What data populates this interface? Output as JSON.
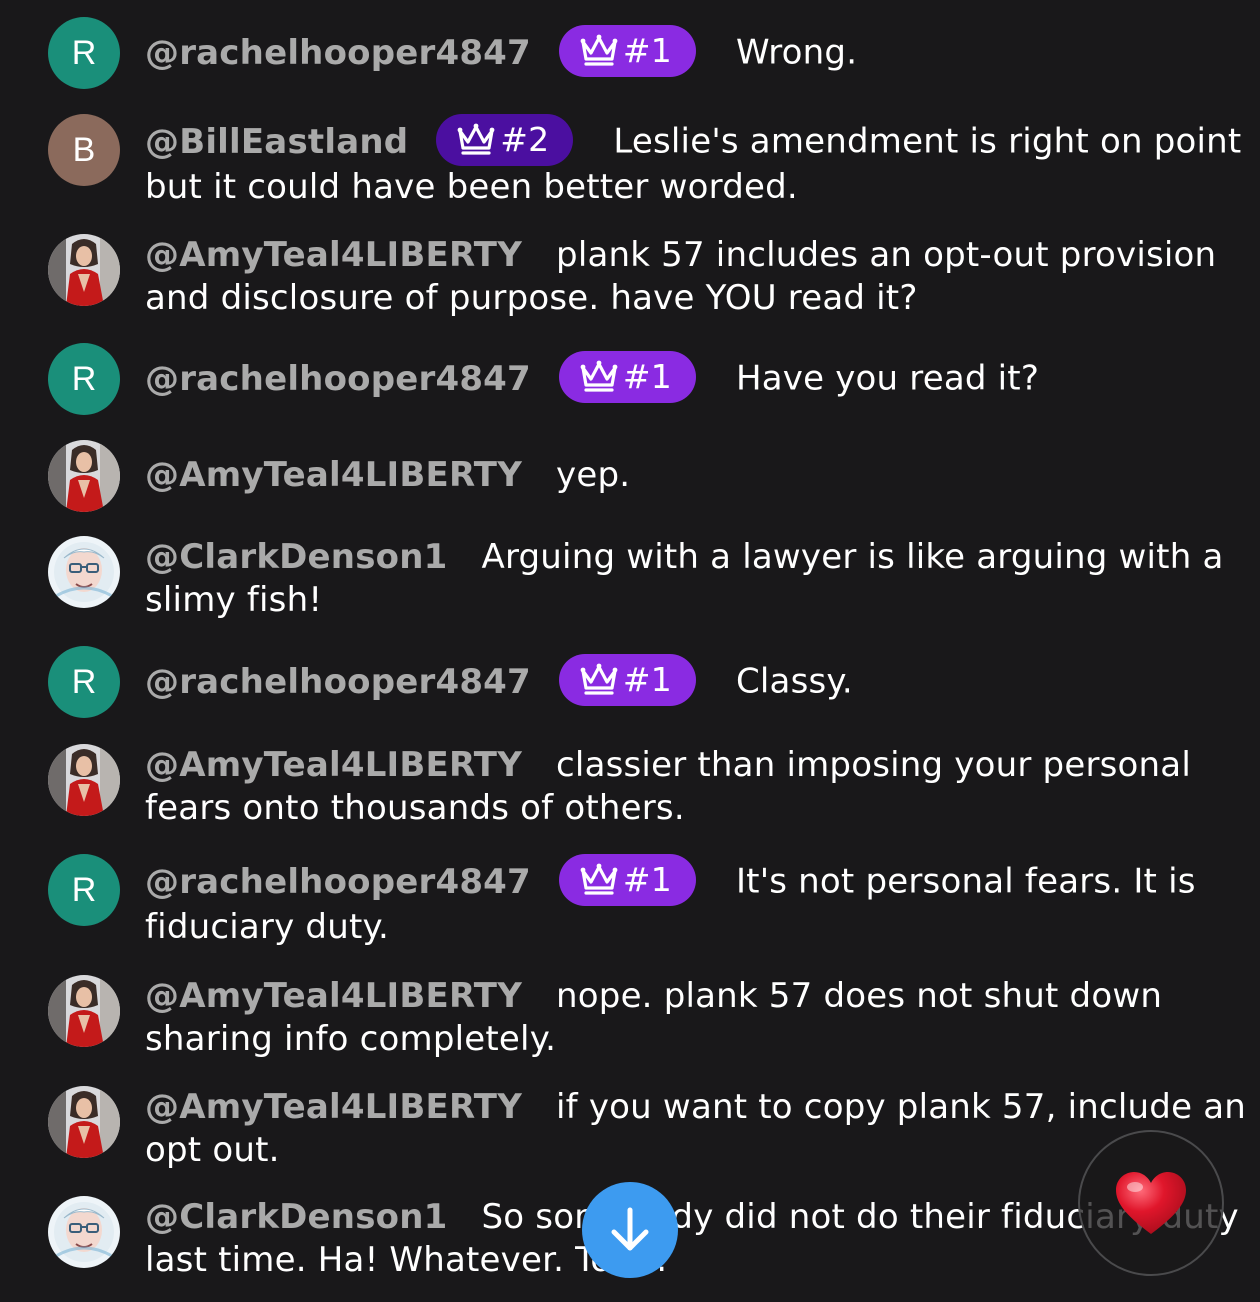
{
  "colors": {
    "background": "#19181a",
    "author": "#aaaaaa",
    "badge_rank1": "#8a2be2",
    "badge_rank2": "#4b0fa0",
    "avatar_r": "#1a8f7a",
    "avatar_b": "#8b6a5c",
    "scroll_button": "#3d9bf0",
    "heart": "#e0162b"
  },
  "messages": [
    {
      "avatar_letter": "R",
      "author": "@rachelhooper4847",
      "badge": "#1",
      "text": "Wrong."
    },
    {
      "avatar_letter": "B",
      "author": "@BillEastland",
      "badge": "#2",
      "text": "Leslie's amendment is right on point",
      "text2": "but it could have been better worded."
    },
    {
      "author": "@AmyTeal4LIBERTY",
      "text": "plank 57 includes an opt-out provision",
      "text2": "and disclosure of purpose. have YOU read it?"
    },
    {
      "avatar_letter": "R",
      "author": "@rachelhooper4847",
      "badge": "#1",
      "text": "Have you read it?"
    },
    {
      "author": "@AmyTeal4LIBERTY",
      "text": "yep."
    },
    {
      "author": "@ClarkDenson1",
      "text": "Arguing with a lawyer is like arguing with a",
      "text2": "slimy fish!"
    },
    {
      "avatar_letter": "R",
      "author": "@rachelhooper4847",
      "badge": "#1",
      "text": "Classy."
    },
    {
      "author": "@AmyTeal4LIBERTY",
      "text": "classier than imposing your personal",
      "text2": "fears onto thousands of others."
    },
    {
      "avatar_letter": "R",
      "author": "@rachelhooper4847",
      "badge": "#1",
      "text": "It's not personal fears. It is",
      "text2": "fiduciary duty."
    },
    {
      "author": "@AmyTeal4LIBERTY",
      "text": "nope. plank 57 does not shut down",
      "text2": "sharing info completely."
    },
    {
      "author": "@AmyTeal4LIBERTY",
      "text": "if you want to copy plank 57, include an",
      "text2": "opt out."
    },
    {
      "author": "@ClarkDenson1",
      "text": "So somebody did not do their fiduciary duty",
      "text2": "last time. Ha! Whatever. ToSS!"
    }
  ],
  "icons": {
    "badge": "crown-icon",
    "scroll": "arrow-down-icon",
    "reaction": "heart-icon"
  }
}
